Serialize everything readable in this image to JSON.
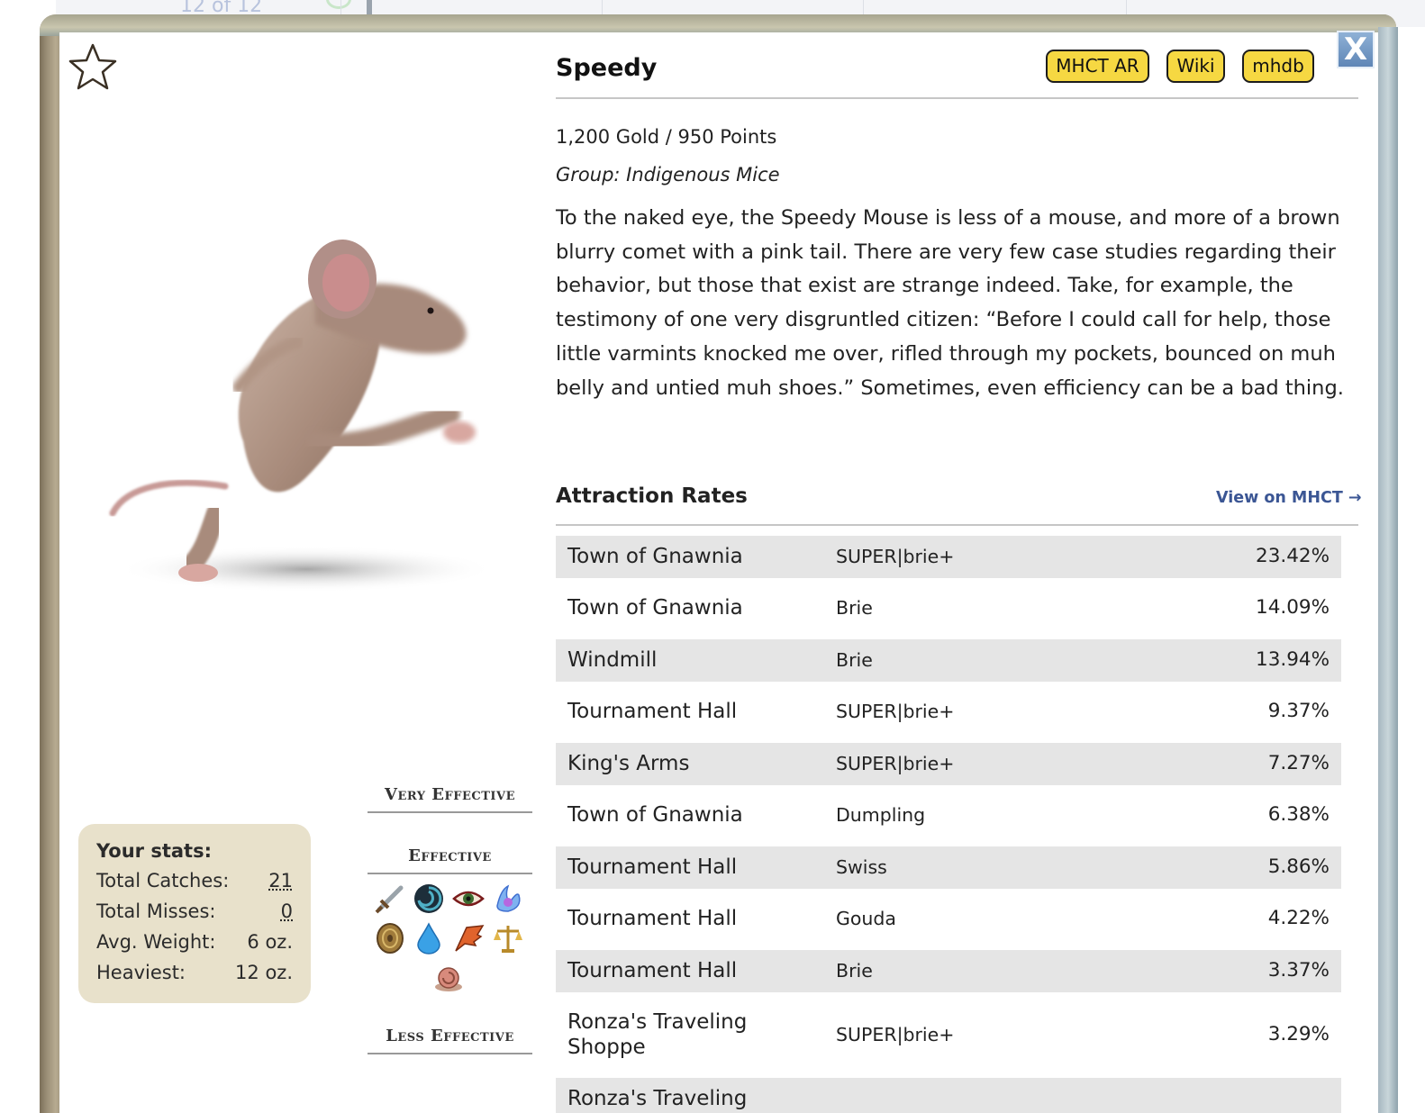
{
  "background": {
    "pager_text": "12 of 12"
  },
  "popup": {
    "close_label": "X",
    "mouse": {
      "name": "Speedy",
      "price": "1,200 Gold / 950 Points",
      "group": "Group: Indigenous Mice",
      "description": "To the naked eye, the Speedy Mouse is less of a mouse, and more of a brown blurry comet with a pink tail. There are very few case studies regarding their behavior, but those that exist are strange indeed. Take, for example, the testimony of one very disgruntled citizen: “Before I could call for help, those little varmints knocked me over, rifled through my pockets, bounced on muh belly and untied muh shoes.” Sometimes, even efficiency can be a bad thing."
    },
    "buttons": {
      "mhct_ar": "MHCT AR",
      "wiki": "Wiki",
      "mhdb": "mhdb"
    },
    "stats": {
      "title": "Your stats:",
      "rows": [
        {
          "label": "Total Catches:",
          "value": "21"
        },
        {
          "label": "Total Misses:",
          "value": "0"
        },
        {
          "label": "Avg. Weight:",
          "value": "6 oz."
        },
        {
          "label": "Heaviest:",
          "value": "12 oz."
        }
      ]
    },
    "effectiveness": {
      "very_effective": "Very Effective",
      "effective": "Effective",
      "less_effective": "Less Effective",
      "effective_icons": [
        "tactical-sword-icon",
        "shadow-vortex-icon",
        "arcane-eye-icon",
        "hydro-splash-icon",
        "physical-shield-icon",
        "hydro-droplet-icon",
        "dragon-wing-icon",
        "law-scales-icon",
        "rift-snail-icon"
      ]
    },
    "attraction": {
      "title": "Attraction Rates",
      "link": "View on MHCT →",
      "rows": [
        {
          "location": "Town of Gnawnia",
          "bait": "SUPER|brie+",
          "rate": "23.42%"
        },
        {
          "location": "Town of Gnawnia",
          "bait": "Brie",
          "rate": "14.09%"
        },
        {
          "location": "Windmill",
          "bait": "Brie",
          "rate": "13.94%"
        },
        {
          "location": "Tournament Hall",
          "bait": "SUPER|brie+",
          "rate": "9.37%"
        },
        {
          "location": "King's Arms",
          "bait": "SUPER|brie+",
          "rate": "7.27%"
        },
        {
          "location": "Town of Gnawnia",
          "bait": "Dumpling",
          "rate": "6.38%"
        },
        {
          "location": "Tournament Hall",
          "bait": "Swiss",
          "rate": "5.86%"
        },
        {
          "location": "Tournament Hall",
          "bait": "Gouda",
          "rate": "4.22%"
        },
        {
          "location": "Tournament Hall",
          "bait": "Brie",
          "rate": "3.37%"
        },
        {
          "location": "Ronza's Traveling Shoppe",
          "bait": "SUPER|brie+",
          "rate": "3.29%"
        },
        {
          "location": "Ronza's Traveling",
          "bait": "",
          "rate": ""
        }
      ]
    }
  }
}
